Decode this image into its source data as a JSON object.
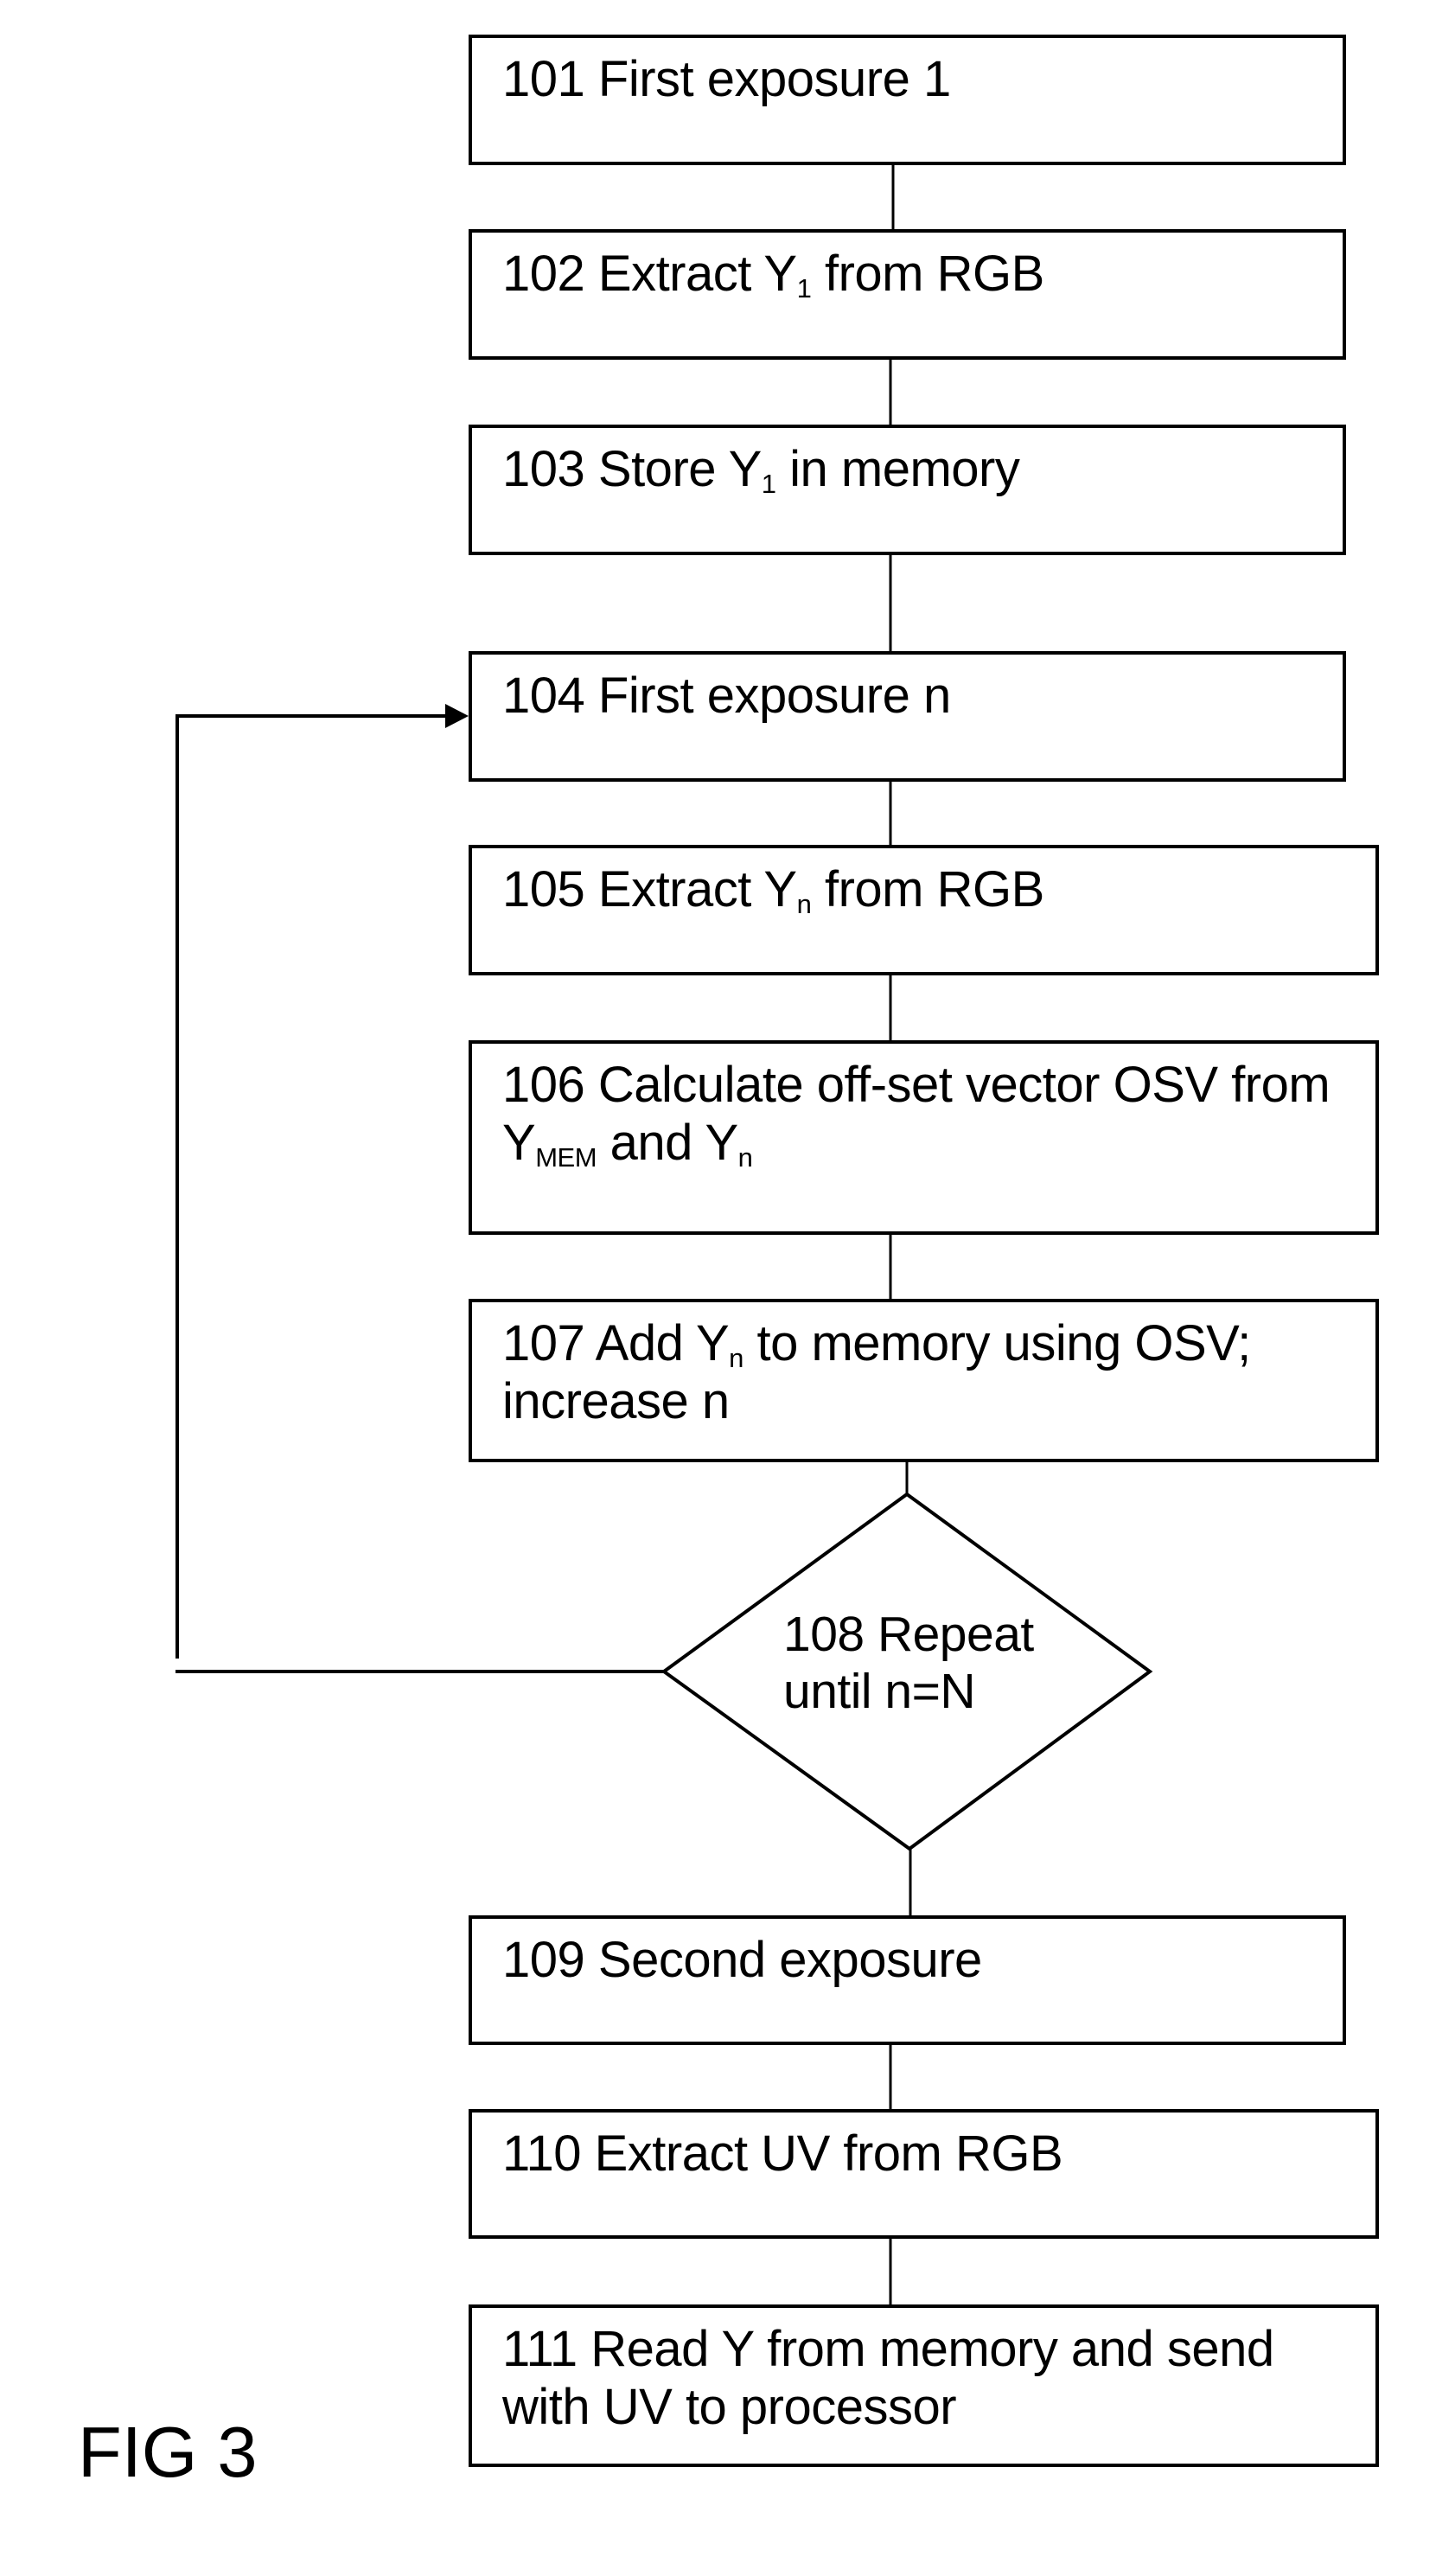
{
  "figure": {
    "label": "FIG 3",
    "colors": {
      "stroke": "#000000",
      "background": "#ffffff"
    }
  },
  "steps": [
    {
      "id": "101",
      "type": "process",
      "lines": [
        [
          {
            "t": "101 First exposure 1"
          }
        ]
      ]
    },
    {
      "id": "102",
      "type": "process",
      "lines": [
        [
          {
            "t": "102 Extract Y"
          },
          {
            "sub": "1"
          },
          {
            "t": " from RGB"
          }
        ]
      ]
    },
    {
      "id": "103",
      "type": "process",
      "lines": [
        [
          {
            "t": "103 Store Y"
          },
          {
            "sub": "1"
          },
          {
            "t": " in memory"
          }
        ]
      ]
    },
    {
      "id": "104",
      "type": "process",
      "lines": [
        [
          {
            "t": "104 First exposure n"
          }
        ]
      ]
    },
    {
      "id": "105",
      "type": "process",
      "lines": [
        [
          {
            "t": "105 Extract Y"
          },
          {
            "sub": "n"
          },
          {
            "t": " from RGB"
          }
        ]
      ]
    },
    {
      "id": "106",
      "type": "process",
      "lines": [
        [
          {
            "t": "106 Calculate off-set vector OSV from"
          }
        ],
        [
          {
            "t": "Y"
          },
          {
            "sub": "MEM"
          },
          {
            "t": " and Y"
          },
          {
            "sub": "n"
          }
        ]
      ]
    },
    {
      "id": "107",
      "type": "process",
      "lines": [
        [
          {
            "t": "107 Add Y"
          },
          {
            "sub": "n"
          },
          {
            "t": " to memory using OSV;"
          }
        ],
        [
          {
            "t": "increase n"
          }
        ]
      ]
    },
    {
      "id": "108",
      "type": "decision",
      "lines": [
        [
          {
            "t": "108 Repeat"
          }
        ],
        [
          {
            "t": "until n=N"
          }
        ]
      ]
    },
    {
      "id": "109",
      "type": "process",
      "lines": [
        [
          {
            "t": "109 Second exposure"
          }
        ]
      ]
    },
    {
      "id": "110",
      "type": "process",
      "lines": [
        [
          {
            "t": "110 Extract UV from RGB"
          }
        ]
      ]
    },
    {
      "id": "111",
      "type": "process",
      "lines": [
        [
          {
            "t": "111 Read Y from memory and send"
          }
        ],
        [
          {
            "t": "with UV to processor"
          }
        ]
      ]
    }
  ],
  "edges": [
    {
      "from": "101",
      "to": "102",
      "arrow": false
    },
    {
      "from": "102",
      "to": "103",
      "arrow": false
    },
    {
      "from": "103",
      "to": "104",
      "arrow": false
    },
    {
      "from": "104",
      "to": "105",
      "arrow": false
    },
    {
      "from": "105",
      "to": "106",
      "arrow": false
    },
    {
      "from": "106",
      "to": "107",
      "arrow": false
    },
    {
      "from": "107",
      "to": "108",
      "arrow": false
    },
    {
      "from": "108",
      "to": "104",
      "arrow": true,
      "kind": "loop-back"
    },
    {
      "from": "108",
      "to": "109",
      "arrow": false
    },
    {
      "from": "109",
      "to": "110",
      "arrow": false
    },
    {
      "from": "110",
      "to": "111",
      "arrow": false
    }
  ]
}
